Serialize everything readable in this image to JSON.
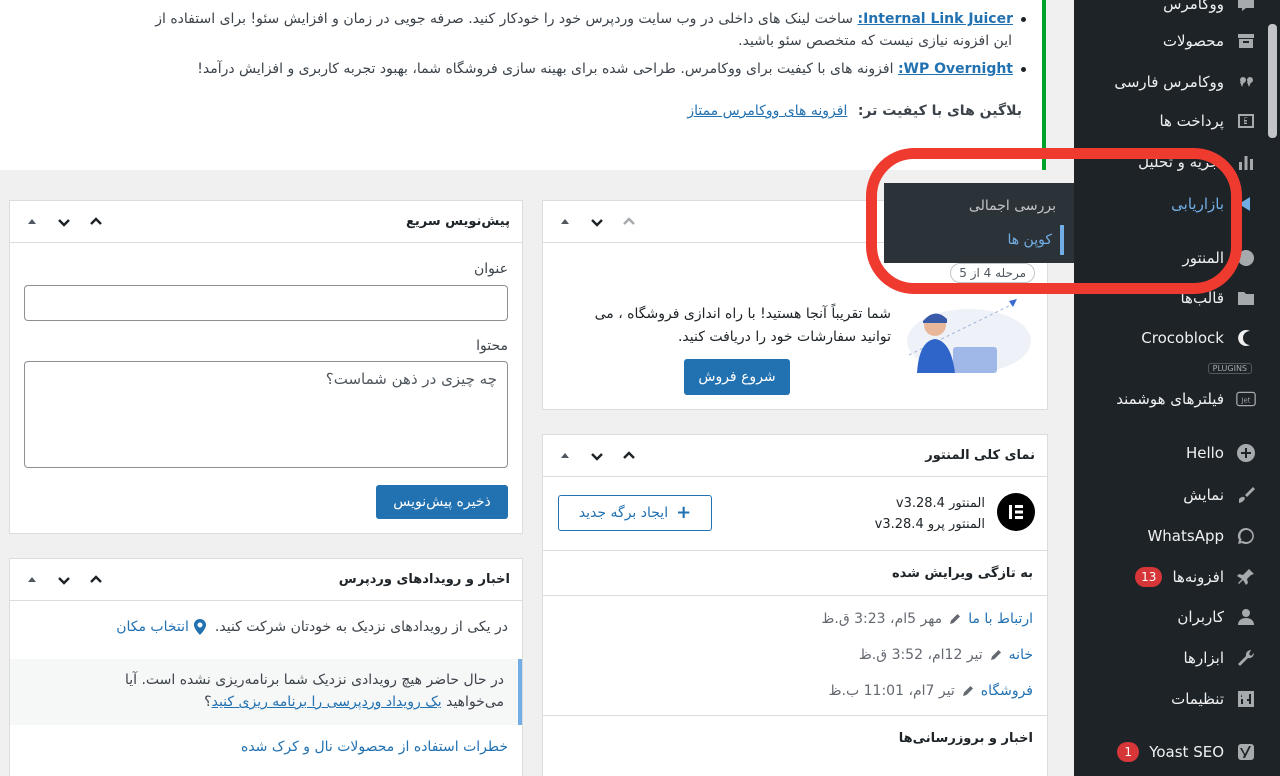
{
  "sidebar": {
    "items": [
      {
        "label": "ووکامرس",
        "icon": "woocommerce-icon"
      },
      {
        "label": "محصولات",
        "icon": "archive-icon"
      },
      {
        "label": "ووکامرس فارسی",
        "icon": "persian-woo-icon"
      },
      {
        "label": "پرداخت ها",
        "icon": "payment-icon"
      },
      {
        "label": "تجزیه و تحلیل",
        "icon": "analytics-icon"
      },
      {
        "label": "بازاریابی",
        "icon": "megaphone-icon"
      },
      {
        "label": "المنتور",
        "icon": "elementor-icon"
      },
      {
        "label": "قالب‌ها",
        "icon": "folder-icon"
      },
      {
        "label": "Crocoblock",
        "icon": "crocoblock-icon"
      },
      {
        "label": "فیلترهای هوشمند",
        "icon": "jet-icon"
      },
      {
        "label": "Hello",
        "icon": "plus-circle-icon"
      },
      {
        "label": "نمایش",
        "icon": "brush-icon"
      },
      {
        "label": "WhatsApp",
        "icon": "whatsapp-icon"
      },
      {
        "label": "افزونه‌ها",
        "icon": "plugin-icon",
        "badge": "13"
      },
      {
        "label": "کاربران",
        "icon": "user-icon"
      },
      {
        "label": "ابزارها",
        "icon": "wrench-icon"
      },
      {
        "label": "تنظیمات",
        "icon": "settings-icon"
      },
      {
        "label": "Yoast SEO",
        "icon": "yoast-icon",
        "badge": "1"
      }
    ],
    "plugins_tag": "PLUGINS",
    "flyout": {
      "items": [
        "بررسی اجمالی",
        "کوپن ها"
      ]
    }
  },
  "notice": {
    "item1_link": "Internal Link Juicer:",
    "item1_text": " ساخت لینک های داخلی در وب سایت وردپرس خود را خودکار کنید. صرفه جویی در زمان و افزایش سئو! برای استفاده از",
    "item1_text2": "این افزونه نیازی نیست که متخصص سئو باشید.",
    "item2_link": "WP Overnight:",
    "item2_text": " افزونه های با کیفیت برای ووکامرس. طراحی شده برای بهینه سازی فروشگاه شما، بهبود تجربه کاربری و افزایش درآمد!",
    "item3_label": "بلاگین های با کیفیت تر:",
    "item3_link": "افزونه های ووکامرس ممتاز"
  },
  "quick_draft": {
    "title": "پیش‌نویس سریع",
    "title_label": "عنوان",
    "content_label": "محتوا",
    "content_placeholder": "چه چیزی در ذهن شماست؟",
    "save_button": "ذخیره پیش‌نویس"
  },
  "wp_events": {
    "title": "اخبار و رویدادهای وردپرس",
    "intro": "در یکی از رویدادهای نزدیک به خودتان شرکت کنید.",
    "select_location": "انتخاب مکان",
    "notice_line1": "در حال حاضر هیچ رویدادی نزدیک شما برنامه‌ریزی نشده است. آیا",
    "notice_line2_pre": "می‌خواهید",
    "notice_link": "یک رویداد وردپرسی را برنامه ریزی کنید",
    "notice_q": "؟",
    "news_link": "خطرات استفاده از محصولات نال و کرک شده"
  },
  "woo_setup": {
    "step": "مرحله 4 از 5",
    "text_line1": "شما تقریباً آنجا هستید! با راه اندازی فروشگاه ، می",
    "text_line2": "توانید سفارشات خود را دریافت کنید.",
    "button": "شروع فروش"
  },
  "elementor": {
    "title": "نمای کلی المنتور",
    "version_label": "المنتور",
    "version": "v3.28.4",
    "pro_label": "المنتور پرو",
    "pro_version": "v3.28.4",
    "create_button": "ایجاد برگه جدید",
    "recent_title": "به تازگی ویرایش شده",
    "recent": [
      {
        "name": "ارتباط با ما",
        "date": "مهر 5ام، 3:23 ق.ظ"
      },
      {
        "name": "خانه",
        "date": "تیر 12ام، 3:52 ق.ظ"
      },
      {
        "name": "فروشگاه",
        "date": "تیر 7ام، 11:01 ب.ظ"
      }
    ],
    "news_title": "اخبار و بروزرسانی‌ها"
  },
  "colors": {
    "accent": "#2271b1",
    "sidebar": "#1d2327",
    "annotation": "#ef3a2f",
    "notice_border": "#00a32a"
  }
}
